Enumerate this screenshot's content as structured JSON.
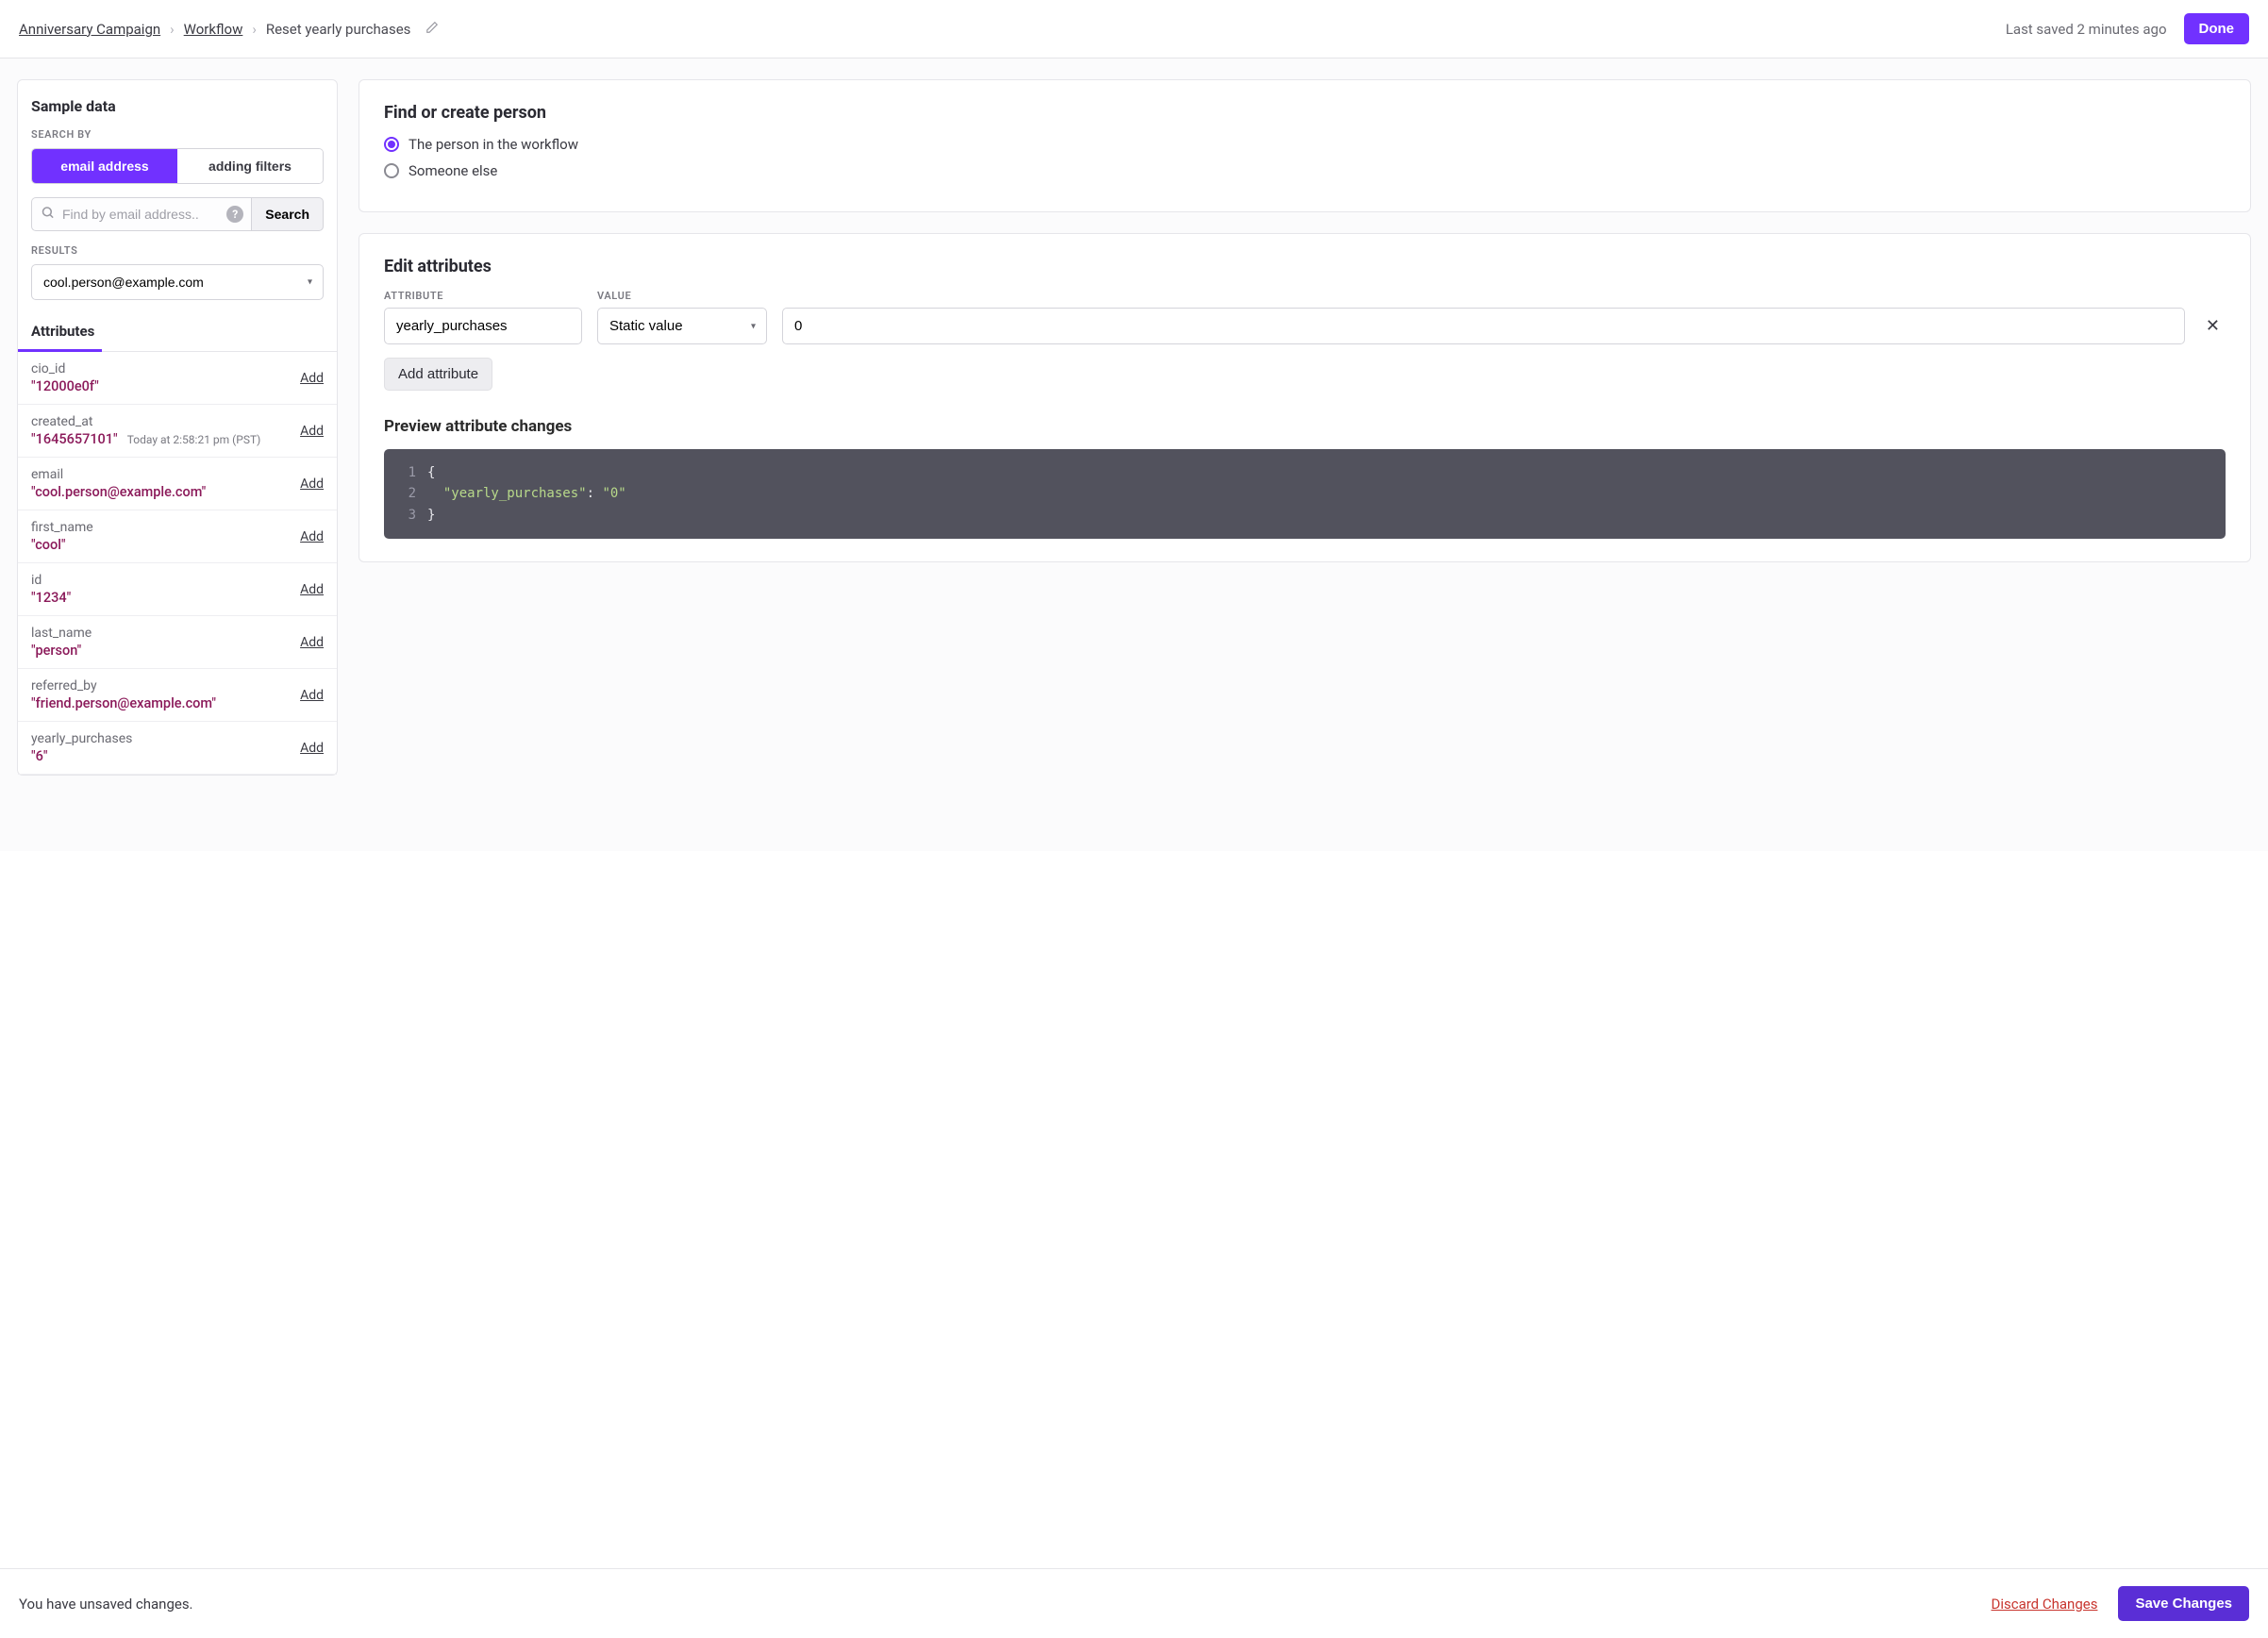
{
  "header": {
    "breadcrumb": [
      "Anniversary Campaign",
      "Workflow",
      "Reset yearly purchases"
    ],
    "saved_text": "Last saved 2 minutes ago",
    "done_label": "Done"
  },
  "sidebar": {
    "title": "Sample data",
    "search_by_label": "SEARCH BY",
    "toggle": {
      "email": "email address",
      "filters": "adding filters"
    },
    "search_placeholder": "Find by email address..",
    "search_button": "Search",
    "results_label": "RESULTS",
    "selected_result": "cool.person@example.com",
    "tab_label": "Attributes",
    "add_label": "Add",
    "attributes": [
      {
        "key": "cio_id",
        "value": "\"12000e0f\"",
        "meta": ""
      },
      {
        "key": "created_at",
        "value": "\"1645657101\"",
        "meta": "Today at 2:58:21 pm (PST)"
      },
      {
        "key": "email",
        "value": "\"cool.person@example.com\"",
        "meta": ""
      },
      {
        "key": "first_name",
        "value": "\"cool\"",
        "meta": ""
      },
      {
        "key": "id",
        "value": "\"1234\"",
        "meta": ""
      },
      {
        "key": "last_name",
        "value": "\"person\"",
        "meta": ""
      },
      {
        "key": "referred_by",
        "value": "\"friend.person@example.com\"",
        "meta": ""
      },
      {
        "key": "yearly_purchases",
        "value": "\"6\"",
        "meta": ""
      }
    ]
  },
  "find_panel": {
    "title": "Find or create person",
    "option1": "The person in the workflow",
    "option2": "Someone else"
  },
  "edit_panel": {
    "title": "Edit attributes",
    "attr_label": "ATTRIBUTE",
    "value_label": "VALUE",
    "attr_value": "yearly_purchases",
    "type_value": "Static value",
    "val_value": "0",
    "add_attr_label": "Add attribute",
    "preview_title": "Preview attribute changes",
    "code_lines": [
      "{",
      "  \"yearly_purchases\": \"0\"",
      "}"
    ]
  },
  "footer": {
    "message": "You have unsaved changes.",
    "discard": "Discard Changes",
    "save": "Save Changes"
  }
}
